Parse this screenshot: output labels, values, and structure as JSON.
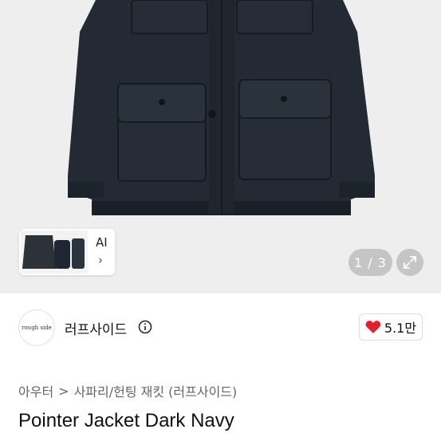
{
  "hero": {
    "ai_label": "AI",
    "ai_chevron": "›",
    "counter": "1 / 3",
    "expand_icon": "expand-icon"
  },
  "seller": {
    "avatar_text": "rough side",
    "name": "러프사이드",
    "info_icon": "info-icon",
    "likes": "5.1만",
    "heart_color": "#e5202e"
  },
  "breadcrumb": {
    "items": [
      "아우터",
      "사파리/헌팅 재킷 (러프사이드)"
    ],
    "separator": ">"
  },
  "product": {
    "title": "Pointer Jacket Dark Navy"
  }
}
